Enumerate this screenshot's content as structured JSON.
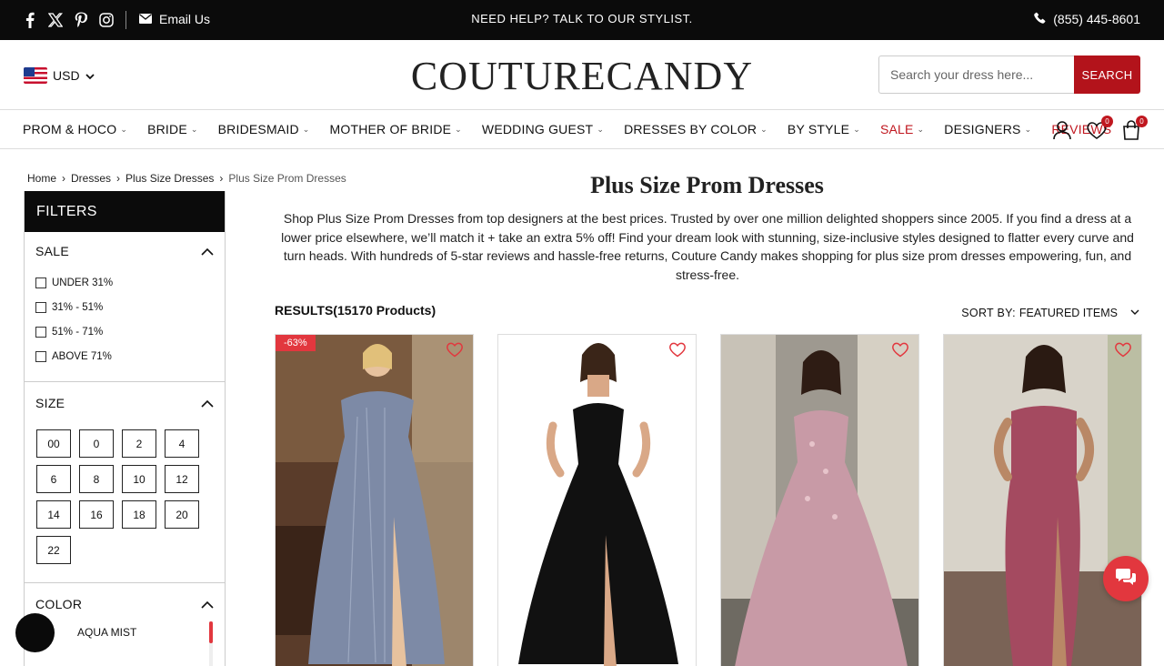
{
  "topbar": {
    "email_label": "Email Us",
    "help_text": "NEED HELP? TALK TO OUR STYLIST.",
    "phone": "(855) 445-8601",
    "social_icons": [
      "facebook-icon",
      "x-icon",
      "pinterest-icon",
      "instagram-icon"
    ]
  },
  "header": {
    "currency": "USD",
    "logo": "COUTURECANDY",
    "search_placeholder": "Search your dress here...",
    "search_button": "SEARCH"
  },
  "nav": {
    "items": [
      {
        "label": "PROM & HOCO",
        "dropdown": true
      },
      {
        "label": "BRIDE",
        "dropdown": true
      },
      {
        "label": "BRIDESMAID",
        "dropdown": true
      },
      {
        "label": "MOTHER OF BRIDE",
        "dropdown": true
      },
      {
        "label": "WEDDING GUEST",
        "dropdown": true
      },
      {
        "label": "DRESSES BY COLOR",
        "dropdown": true
      },
      {
        "label": "BY STYLE",
        "dropdown": true
      },
      {
        "label": "SALE",
        "dropdown": true
      },
      {
        "label": "DESIGNERS",
        "dropdown": true
      },
      {
        "label": "REVIEWS",
        "dropdown": false
      }
    ],
    "wishlist_count": "0",
    "cart_count": "0"
  },
  "breadcrumb": [
    "Home",
    "Dresses",
    "Plus Size Dresses",
    "Plus Size Prom Dresses"
  ],
  "filters": {
    "heading": "FILTERS",
    "sale": {
      "title": "SALE",
      "options": [
        "UNDER 31%",
        "31% - 51%",
        "51% - 71%",
        "ABOVE 71%"
      ]
    },
    "size": {
      "title": "SIZE",
      "options": [
        "00",
        "0",
        "2",
        "4",
        "6",
        "8",
        "10",
        "12",
        "14",
        "16",
        "18",
        "20",
        "22"
      ]
    },
    "color": {
      "title": "COLOR",
      "first_option": "AQUA MIST"
    }
  },
  "main": {
    "title": "Plus Size Prom Dresses",
    "description": "Shop Plus Size Prom Dresses from top designers at the best prices. Trusted by over one million delighted shoppers since 2005. If you find a dress at a lower price elsewhere, we’ll match it + take an extra 5% off! Find your dream look with stunning, size-inclusive styles designed to flatter every curve and turn heads. With hundreds of 5-star reviews and hassle-free returns, Couture Candy makes shopping for plus size prom dresses empowering, fun, and stress-free.",
    "results": "RESULTS(15170 Products)",
    "sort_label": "SORT BY:",
    "sort_value": "FEATURED ITEMS"
  },
  "products": [
    {
      "discount": "-63%",
      "dress_color": "#7d8aa6",
      "bg": "#6b4a34",
      "image": "slate-blue-sequin-off-shoulder-gown"
    },
    {
      "discount": "",
      "dress_color": "#111111",
      "bg": "#ffffff",
      "image": "black-strapless-corset-tulle-gown"
    },
    {
      "discount": "",
      "dress_color": "#c89aa6",
      "bg": "#a9a39a",
      "image": "dusty-rose-lace-tulle-gown"
    },
    {
      "discount": "",
      "dress_color": "#a44a60",
      "bg": "#d8d3c9",
      "image": "berry-satin-strapless-gown"
    }
  ],
  "colors": {
    "accent": "#b3131b",
    "sale_red": "#c0171f",
    "badge": "#e2373e"
  }
}
